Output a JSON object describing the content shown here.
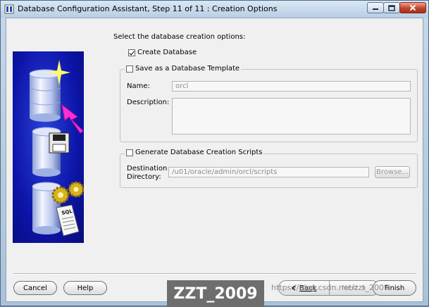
{
  "window": {
    "title": "Database Configuration Assistant, Step 11 of 11 : Creation Options",
    "icons": {
      "app": "database-app-icon",
      "minimize": "minimize-icon",
      "maximize": "maximize-icon",
      "close": "close-icon"
    }
  },
  "content": {
    "prompt": "Select the database creation options:",
    "create_database": {
      "label": "Create Database",
      "checked": true
    },
    "template_group": {
      "label": "Save as a Database Template",
      "checked": false,
      "name_label": "Name:",
      "name_value": "orcl",
      "description_label": "Description:",
      "description_value": ""
    },
    "scripts_group": {
      "label": "Generate Database Creation Scripts",
      "checked": false,
      "destination_label_line1": "Destination",
      "destination_label_line2": "Directory:",
      "destination_value": "/u01/oracle/admin/orcl/scripts",
      "browse_label": "Browse..."
    }
  },
  "buttons": {
    "cancel": "Cancel",
    "help": "Help",
    "back": "Back",
    "next": "Next",
    "finish": "Finish"
  },
  "overlay": {
    "watermark": "ZZT_2009",
    "url": "https://blog.csdn.net/zzt_2009"
  }
}
